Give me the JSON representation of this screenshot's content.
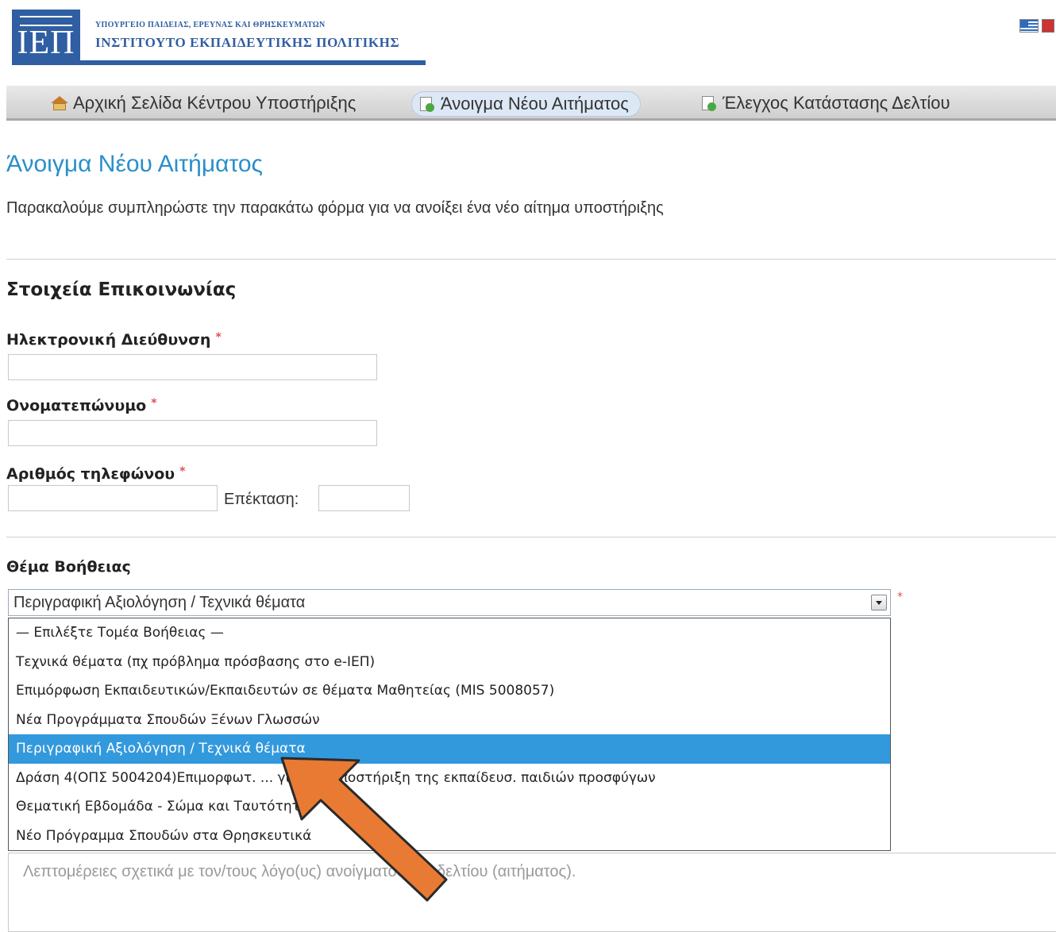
{
  "header": {
    "logo_text": "ΙΕΠ",
    "ministry": "ΥΠΟΥΡΓΕΙΟ ΠΑΙΔΕΙΑΣ, ΕΡΕΥΝΑΣ ΚΑΙ ΘΡΗΣΚΕΥΜΑΤΩΝ",
    "institute": "ΙΝΣΤΙΤΟΥΤΟ ΕΚΠΑΙΔΕΥΤΙΚΗΣ ΠΟΛΙΤΙΚΗΣ"
  },
  "nav": {
    "items": [
      {
        "label": "Αρχική Σελίδα Κέντρου Υποστήριξης",
        "icon": "home-icon",
        "active": false
      },
      {
        "label": "Άνοιγμα Νέου Αιτήματος",
        "icon": "new-ticket-icon",
        "active": true
      },
      {
        "label": "Έλεγχος Κατάστασης Δελτίου",
        "icon": "ticket-status-icon",
        "active": false
      }
    ]
  },
  "page": {
    "title": "Άνοιγμα Νέου Αιτήματος",
    "description": "Παρακαλούμε συμπληρώστε την παρακάτω φόρμα για να ανοίξει ένα νέο αίτημα υποστήριξης"
  },
  "contact": {
    "section_title": "Στοιχεία Επικοινωνίας",
    "email_label": "Ηλεκτρονική Διεύθυνση",
    "email_value": "",
    "name_label": "Ονοματεπώνυμο",
    "name_value": "",
    "phone_label": "Αριθμός τηλεφώνου",
    "phone_value": "",
    "ext_label": "Επέκταση:",
    "ext_value": "",
    "required_mark": "*"
  },
  "help_topic": {
    "label": "Θέμα Βοήθειας",
    "selected": "Περιγραφική Αξιολόγηση / Τεχνικά θέματα",
    "options": [
      "— Επιλέξτε Τομέα Βοήθειας —",
      "Τεχνικά θέματα (πχ πρόβλημα πρόσβασης στο e-ΙΕΠ)",
      "Επιμόρφωση Εκπαιδευτικών/Εκπαιδευτών σε θέματα Μαθητείας (MIS 5008057)",
      "Νέα Προγράμματα Σπουδών Ξένων Γλωσσών",
      "Περιγραφική Αξιολόγηση / Τεχνικά θέματα",
      "Δράση 4(ΟΠΣ 5004204)Επιμορφωτ. ... για την υποστήριξη της εκπαίδευσ. παιδιών προσφύγων",
      "Θεματική Εβδομάδα - Σώμα και Ταυτότητα",
      "Νέο Πρόγραμμα Σπουδών στα Θρησκευτικά"
    ],
    "selected_index": 4
  },
  "details": {
    "placeholder": "Λεπτομέρειες σχετικά με τον/τους λόγο(υς) ανοίγματος του δελτίου (αιτήματος)."
  },
  "colors": {
    "brand_blue": "#2f5ea2",
    "title_blue": "#2a8fc9",
    "selected_option": "#3399dd",
    "annotation_arrow": "#e97a33"
  }
}
